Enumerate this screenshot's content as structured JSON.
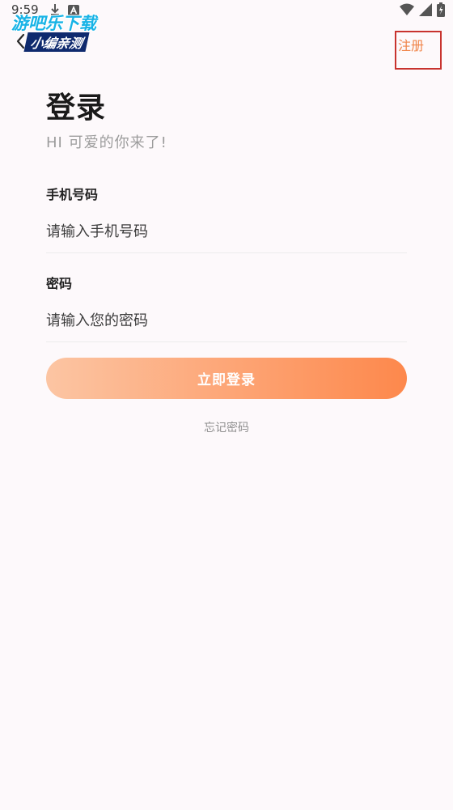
{
  "status_bar": {
    "time": "9:59",
    "icons": [
      "download-icon",
      "a-notification-icon",
      "wifi-icon",
      "signal-icon",
      "battery-icon"
    ]
  },
  "watermark": {
    "line1": "游吧乐下载",
    "line2": "小编亲测"
  },
  "nav": {
    "back_icon": "chevron-left-icon",
    "register_label": "注册"
  },
  "header": {
    "title": "登录",
    "subtitle": "HI 可爱的你来了!"
  },
  "form": {
    "phone": {
      "label": "手机号码",
      "placeholder": "请输入手机号码"
    },
    "password": {
      "label": "密码",
      "placeholder": "请输入您的密码"
    }
  },
  "actions": {
    "login_label": "立即登录",
    "forgot_label": "忘记密码"
  },
  "colors": {
    "background": "#fdf9fb",
    "accent": "#fd884c",
    "accent_light": "#fcc5a3",
    "register_text": "#f0854a",
    "register_outline": "#c8332e",
    "subtitle_text": "#9c9c9c"
  }
}
